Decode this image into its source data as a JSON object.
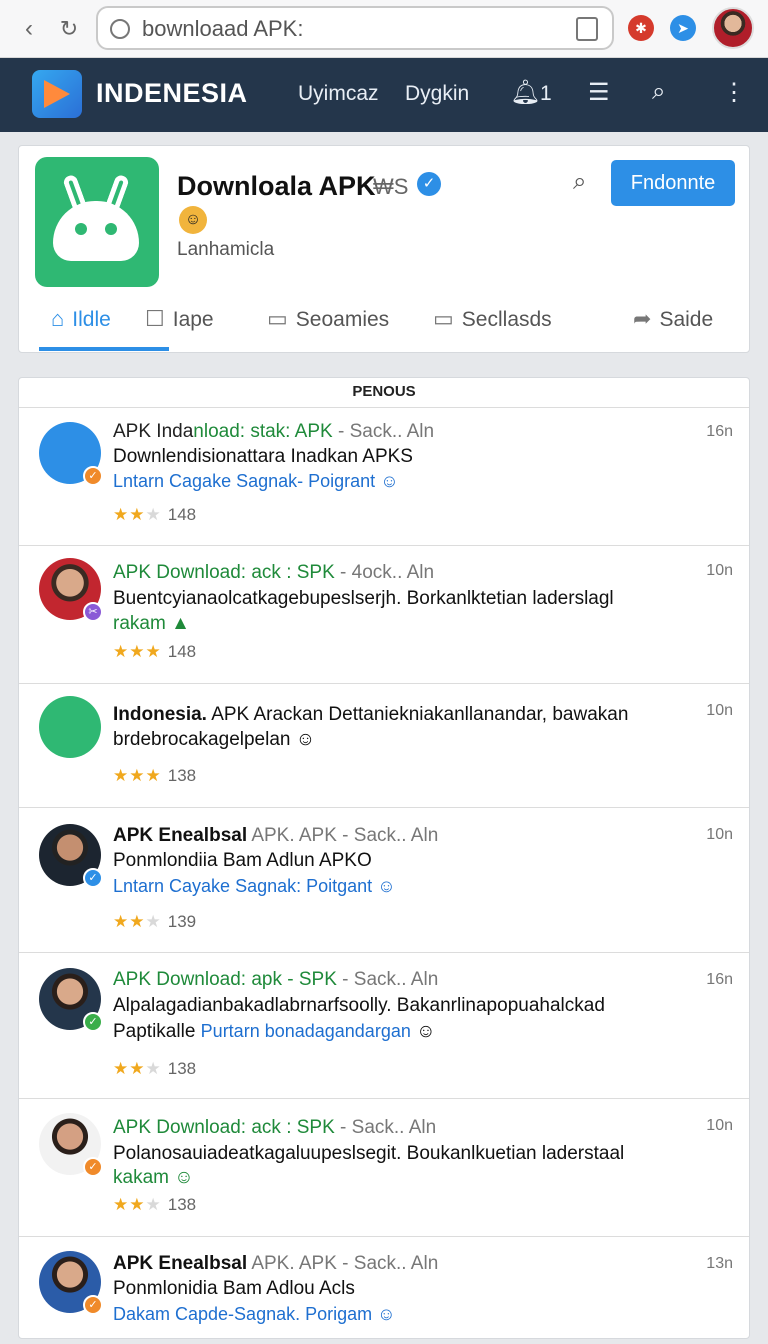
{
  "browser": {
    "url_text": "bownloaad APK:"
  },
  "navbar": {
    "brand": "INDENESIA",
    "links": [
      "Uyimcaz",
      "Dygkin"
    ],
    "notif_count": "1"
  },
  "profile": {
    "title": "Downloala APK",
    "badge": "₩S",
    "subtitle": "Lanhamicla",
    "follow_label": "Fndonnte",
    "tabs": [
      "Ildle",
      "Iape",
      "Seoamies",
      "Secllasds",
      "Saide"
    ]
  },
  "feed": {
    "header": "PENOUS",
    "posts": [
      {
        "head_a": "APK Inda",
        "head_b": "nload: stak: APK",
        "head_c": " - Sack.. Aln",
        "body": "Downlendisionattara Inadkan APKS",
        "link": "Lntarn Cagake Sagnak- Poigrant",
        "rating": "148",
        "time": "16n"
      },
      {
        "head_a": "",
        "head_b": "APK Download: ack : SPK",
        "head_c": " - 4ock.. Aln",
        "body": "Buentcyianaolcatkagebupeslserjh. Borkanlktetian laderslagl",
        "link": "rakam",
        "rating": "148",
        "time": "10n"
      },
      {
        "head_a": "Indonesia.",
        "head_b": "",
        "head_c": " APK Arackan Dettaniekniakanllanandar, bawakan",
        "body": "brdebrocakagelpelan",
        "link": "",
        "rating": "138",
        "time": "10n"
      },
      {
        "head_a": "APK Enealbsal",
        "head_b": "",
        "head_c": " APK. APK - Sack.. Aln",
        "body": "Ponmlondiia Bam Adlun APKO",
        "link": "Lntarn Cayake Sagnak: Poitgant",
        "rating": "139",
        "time": "10n"
      },
      {
        "head_a": "",
        "head_b": "APK Download: apk - SPK",
        "head_c": " - Sack.. Aln",
        "body": "Alpalagadianbakadlabrnarfsoolly. Bakanrlinapopuahalckad",
        "body2": "Paptikalle",
        "link": "Purtarn bonadagandargan",
        "rating": "138",
        "time": "16n"
      },
      {
        "head_a": "",
        "head_b": "APK Download: ack : SPK",
        "head_c": " - Sack.. Aln",
        "body": "Polanosauiadeatkagaluupeslsegit. Boukanlkuetian laderstaal",
        "link": "kakam",
        "rating": "138",
        "time": "10n"
      },
      {
        "head_a": "APK Enealbsal",
        "head_b": "",
        "head_c": " APK. APK - Sack.. Aln",
        "body": "Ponmlonidia Bam Adlou Acls",
        "link": "Dakam Capde-Sagnak. Porigam",
        "rating": "",
        "time": "13n"
      }
    ]
  },
  "colors": {
    "navbar": "#24364b",
    "accent": "#2d8fe6",
    "green": "#1f8a3a",
    "app_icon": "#2fb873"
  }
}
